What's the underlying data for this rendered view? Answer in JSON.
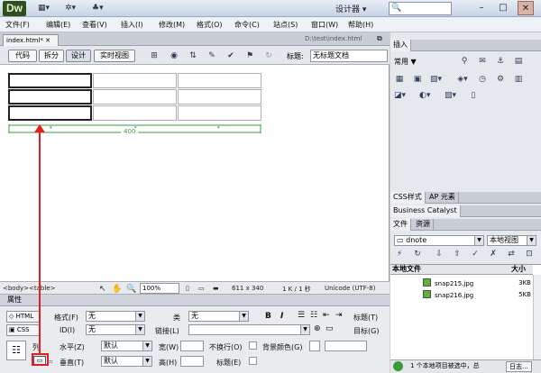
{
  "app": {
    "logo": "Dw",
    "workspace": "设计器",
    "window_controls": [
      "–",
      "□",
      "✕"
    ]
  },
  "menus": [
    "文件(F)",
    "编辑(E)",
    "查看(V)",
    "插入(I)",
    "修改(M)",
    "格式(O)",
    "命令(C)",
    "站点(S)",
    "窗口(W)",
    "帮助(H)"
  ],
  "document": {
    "tab_label": "index.html*",
    "path": "D:\\test\\index.html"
  },
  "toolbar": {
    "views": [
      "代码",
      "拆分",
      "设计",
      "实时视图"
    ],
    "active_view": "设计",
    "title_label": "标题:",
    "title_value": "无标题文档"
  },
  "canvas": {
    "table": {
      "rows": 3,
      "cols": 3
    },
    "width_label": "400"
  },
  "statusbar": {
    "tags": [
      "<body>",
      "<table>"
    ],
    "zoom": "100%",
    "dimensions": "611 x 340",
    "size_info": "1 K / 1 秒",
    "encoding": "Unicode (UTF-8)"
  },
  "properties": {
    "header": "属性",
    "html_mode": "HTML",
    "css_mode": "CSS",
    "format_label": "格式(F)",
    "format_value": "无",
    "class_label": "类",
    "class_value": "无",
    "id_label": "ID(I)",
    "id_value": "无",
    "link_label": "链接(L)",
    "title_label": "标题(T)",
    "target_label": "目标(G)",
    "bold": "B",
    "italic": "I",
    "row_label": "列",
    "h_align_label": "水平(Z)",
    "h_align_value": "默认",
    "v_align_label": "垂直(T)",
    "v_align_value": "默认",
    "width_label": "宽(W)",
    "height_label": "高(H)",
    "nowrap_label": "不换行(O)",
    "header_cell_label": "标题(E)",
    "bgcolor_label": "背景颜色(G)"
  },
  "insert_panel": {
    "header": "插入",
    "category": "常用",
    "icons": [
      "hyperlink-icon",
      "email-icon",
      "anchor-icon",
      "hrule-icon",
      "table-icon",
      "div-icon",
      "image-icon",
      "media-icon",
      "date-icon",
      "server-icon",
      "comment-icon",
      "head-icon",
      "script-icon",
      "template-icon",
      "library-icon"
    ]
  },
  "panels": {
    "css_tabs": [
      "CSS样式",
      "AP 元素"
    ],
    "business_catalyst": "Business Catalyst",
    "files_tabs": [
      "文件",
      "资源"
    ],
    "site": "dnote",
    "view": "本地视图",
    "list_header_name": "本地文件",
    "list_header_size": "大小",
    "files": [
      {
        "name": "snap215.jpg",
        "size": "3KB"
      },
      {
        "name": "snap216.jpg",
        "size": "5KB"
      }
    ],
    "status": "1 个本地项目被选中，总",
    "log_button": "日志..."
  },
  "colors": {
    "annotation": "#e02020",
    "width_guide": "#3c9a3c"
  }
}
